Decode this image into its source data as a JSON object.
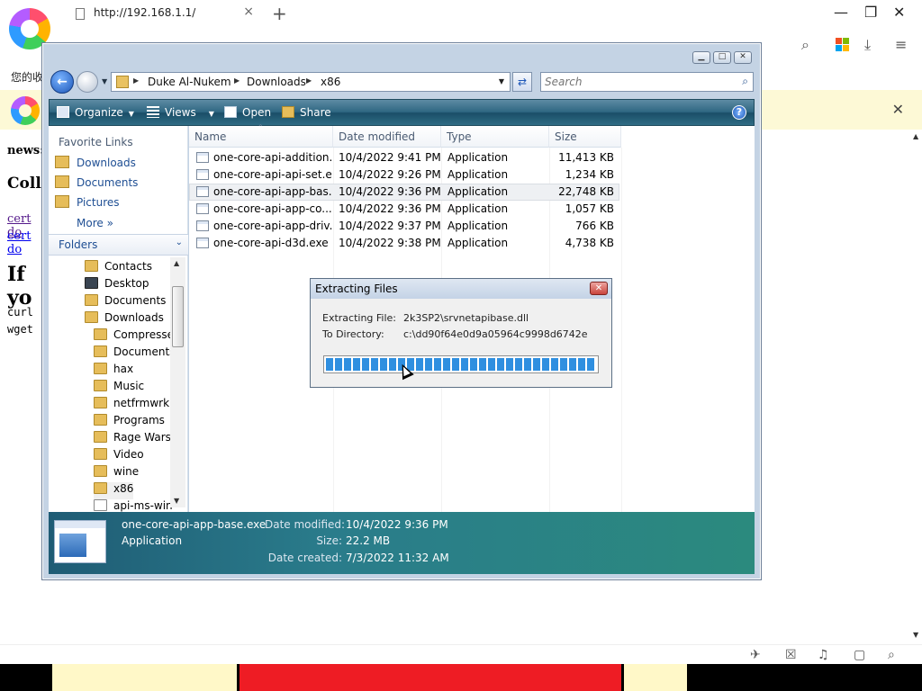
{
  "browser": {
    "tab_title": "http://192.168.1.1/",
    "tab_close": "×",
    "new_tab": "+",
    "minimize": "—",
    "restore": "❐",
    "close": "✕",
    "bookmark_text": "您的收",
    "infobar_close": "✕"
  },
  "webpage": {
    "news": "news:",
    "heading": "Colla",
    "link1": "cert do",
    "link2": "cert do",
    "heading2": "If yo",
    "cmd1": "curl",
    "cmd2": "wget"
  },
  "explorer": {
    "breadcrumb": [
      "Duke Al-Nukem",
      "Downloads",
      "x86"
    ],
    "search_placeholder": "Search",
    "toolbar": {
      "organize": "Organize",
      "views": "Views",
      "open": "Open",
      "share": "Share",
      "help": "?"
    },
    "favorites_header": "Favorite Links",
    "favorites": [
      "Downloads",
      "Documents",
      "Pictures"
    ],
    "more": "More",
    "folders_label": "Folders",
    "tree": [
      "Contacts",
      "Desktop",
      "Documents",
      "Downloads",
      "Compressed",
      "Documents",
      "hax",
      "Music",
      "netfrmwrk",
      "Programs",
      "Rage Wars",
      "Video",
      "wine",
      "x86",
      "api-ms-win-"
    ],
    "columns": [
      "Name",
      "Date modified",
      "Type",
      "Size"
    ],
    "files": [
      {
        "name": "one-core-api-addition...",
        "date": "10/4/2022 9:41 PM",
        "type": "Application",
        "size": "11,413 KB"
      },
      {
        "name": "one-core-api-api-set.exe",
        "date": "10/4/2022 9:26 PM",
        "type": "Application",
        "size": "1,234 KB"
      },
      {
        "name": "one-core-api-app-bas...",
        "date": "10/4/2022 9:36 PM",
        "type": "Application",
        "size": "22,748 KB"
      },
      {
        "name": "one-core-api-app-co...",
        "date": "10/4/2022 9:36 PM",
        "type": "Application",
        "size": "1,057 KB"
      },
      {
        "name": "one-core-api-app-driv...",
        "date": "10/4/2022 9:37 PM",
        "type": "Application",
        "size": "766 KB"
      },
      {
        "name": "one-core-api-d3d.exe",
        "date": "10/4/2022 9:38 PM",
        "type": "Application",
        "size": "4,738 KB"
      }
    ],
    "details": {
      "filename": "one-core-api-app-base.exe",
      "type": "Application",
      "date_modified_label": "Date modified:",
      "date_modified": "10/4/2022 9:36 PM",
      "size_label": "Size:",
      "size": "22.2 MB",
      "date_created_label": "Date created:",
      "date_created": "7/3/2022 11:32 AM"
    }
  },
  "dialog": {
    "title": "Extracting Files",
    "file_label": "Extracting File:",
    "file_value": "2k3SP2\\srvnetapibase.dll",
    "dir_label": "To Directory:",
    "dir_value": "c:\\dd90f64e0d9a05964c9998d6742e",
    "progress_percent": 100
  },
  "colors": {
    "command_bar": "#2f6782",
    "details_pane": "#2a7c8b",
    "progress": "#2f8fe0",
    "infobar": "#fdf9d6"
  }
}
